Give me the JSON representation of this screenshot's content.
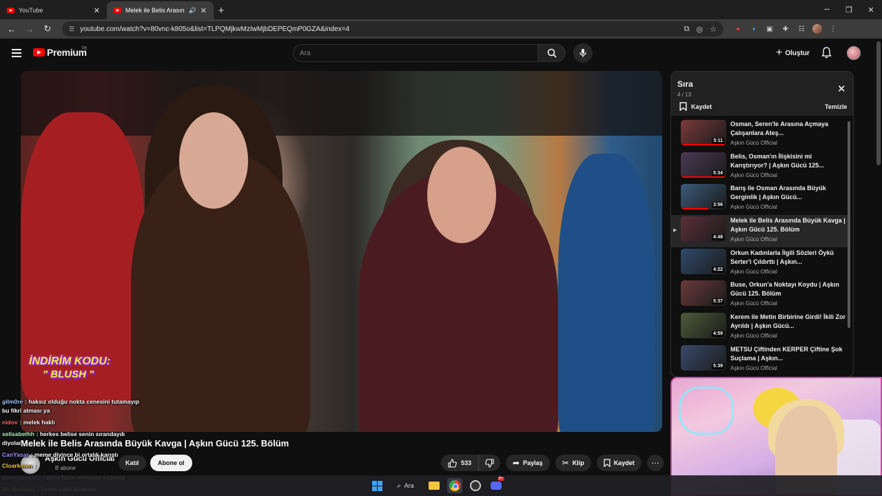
{
  "browser": {
    "tabs": [
      {
        "label": "YouTube",
        "active": false
      },
      {
        "label": "Melek ile Belis Arasında Büyü",
        "active": true
      }
    ],
    "url": "youtube.com/watch?v=80vnc-k805o&list=TLPQMjkwMzIwMjbDEPEQmP0GZA&index=4"
  },
  "youtube": {
    "logo_text": "Premium",
    "logo_region": "TR",
    "search_placeholder": "Ara",
    "create_label": "Oluştur"
  },
  "video": {
    "promo_line1": "İNDİRİM KODU:",
    "promo_line2": "\" BLUSH \"",
    "title": "Melek ile Belis Arasında Büyük Kavga | Aşkın Gücü 125. Bölüm",
    "channel": "Aşkın Gücü Official",
    "subscribers": "B abone",
    "join_label": "Katıl",
    "subscribe_label": "Abone ol",
    "likes": "533",
    "share_label": "Paylaş",
    "clip_label": "Klip",
    "save_label": "Kaydet"
  },
  "playlist": {
    "title": "Sıra",
    "position": "4 / 13",
    "save_label": "Kaydet",
    "clear_label": "Temizle",
    "items": [
      {
        "title": "Osman, Seren'le Arasına Açmaya Çalışanlara Ateş...",
        "channel": "Aşkın Gücü Official",
        "duration": "5:11",
        "current": false,
        "progress": 1.0
      },
      {
        "title": "Belis, Osman'ın İlişkisini mi Karıştırıyor? | Aşkın Gücü 125...",
        "channel": "Aşkın Gücü Official",
        "duration": "5:34",
        "current": false,
        "progress": 1.0
      },
      {
        "title": "Barış ile Osman Arasında Büyük Gerginlik | Aşkın Gücü...",
        "channel": "Aşkın Gücü Official",
        "duration": "3:56",
        "current": false,
        "progress": 0.6
      },
      {
        "title": "Melek ile Belis Arasında Büyük Kavga | Aşkın Gücü 125. Bölüm",
        "channel": "Aşkın Gücü Official",
        "duration": "4:48",
        "current": true,
        "progress": 0
      },
      {
        "title": "Orkun Kadınlarla İlgili Sözleri Öykü Serter'i Çıldırttı | Aşkın...",
        "channel": "Aşkın Gücü Official",
        "duration": "4:22",
        "current": false,
        "progress": 0
      },
      {
        "title": "Buse, Orkun'a Noktayı Koydu | Aşkın Gücü 125. Bölüm",
        "channel": "Aşkın Gücü Official",
        "duration": "5:37",
        "current": false,
        "progress": 0
      },
      {
        "title": "Kerem ile Metin Birbirine Girdi! İkili Zor Ayrıldı | Aşkın Gücü...",
        "channel": "Aşkın Gücü Official",
        "duration": "4:59",
        "current": false,
        "progress": 0
      },
      {
        "title": "METSU Çiftinden KERPER Çiftine Şok Suçlama | Aşkın...",
        "channel": "Aşkın Gücü Official",
        "duration": "5:39",
        "current": false,
        "progress": 0
      }
    ]
  },
  "chat": [
    {
      "user": "gilm0re",
      "text": ": haksız olduğu nokta cenesini tutamayıp",
      "color": "#9ec5ff"
    },
    {
      "user": "",
      "text": "bu fikri atması ya",
      "color": "#ffffff"
    },
    {
      "user": "nidov",
      "text": ": melek haklı",
      "color": "#ff6a6a"
    },
    {
      "user": "selisabethh",
      "text": ": herkes belise senin sırandaydı",
      "color": "#b0f0c0"
    },
    {
      "user": "",
      "text": "diyolar",
      "color": "#ffffff"
    },
    {
      "user": "CanYasar",
      "text": ": meme diyince bi ortalık karıştı",
      "color": "#a98cff"
    },
    {
      "user": "Cloarkman",
      "text": ":",
      "color": "#f5c542"
    },
    {
      "user": "pennylane222",
      "text": ": aklın fikrin memede yağmuş",
      "color": "#d7d7ff"
    },
    {
      "user": "Mr_Bellamy",
      "text": ": Seren haklı kısacası",
      "color": "#ffd24a"
    }
  ],
  "taskbar": {
    "search_label": "Ara",
    "discord_badge": "9+"
  },
  "colors": {
    "accent_red": "#ff0000",
    "background": "#0f0f0f",
    "webcam_border": "#d04aa0"
  }
}
